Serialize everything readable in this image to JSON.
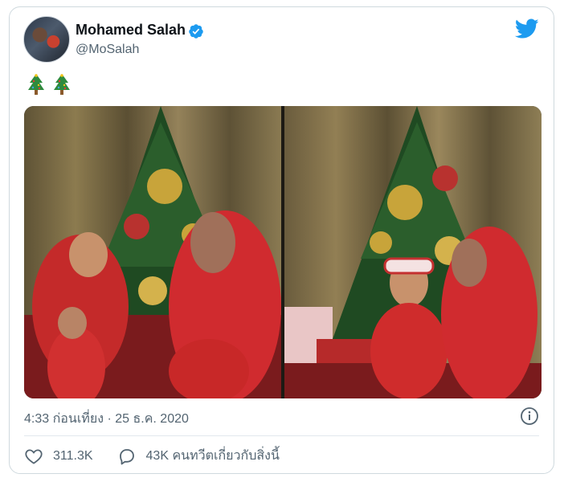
{
  "tweet": {
    "author_name": "Mohamed Salah",
    "handle": "@MoSalah",
    "body_emojis": [
      "christmas-tree",
      "christmas-tree"
    ],
    "timestamp": "4:33 ก่อนเที่ยง · 25 ธ.ค. 2020",
    "like_count": "311.3K",
    "reply_label": "43K คนทวีตเกี่ยวกับสิ่งนี้",
    "verified": true
  },
  "icons": {
    "brand": "twitter-bird-icon",
    "verified": "verified-badge-icon",
    "info": "info-icon",
    "like": "heart-icon",
    "reply": "speech-bubble-icon"
  },
  "colors": {
    "brand_blue": "#1d9bf0",
    "text_primary": "#0f1419",
    "text_secondary": "#536471",
    "border": "#cfd9de"
  }
}
